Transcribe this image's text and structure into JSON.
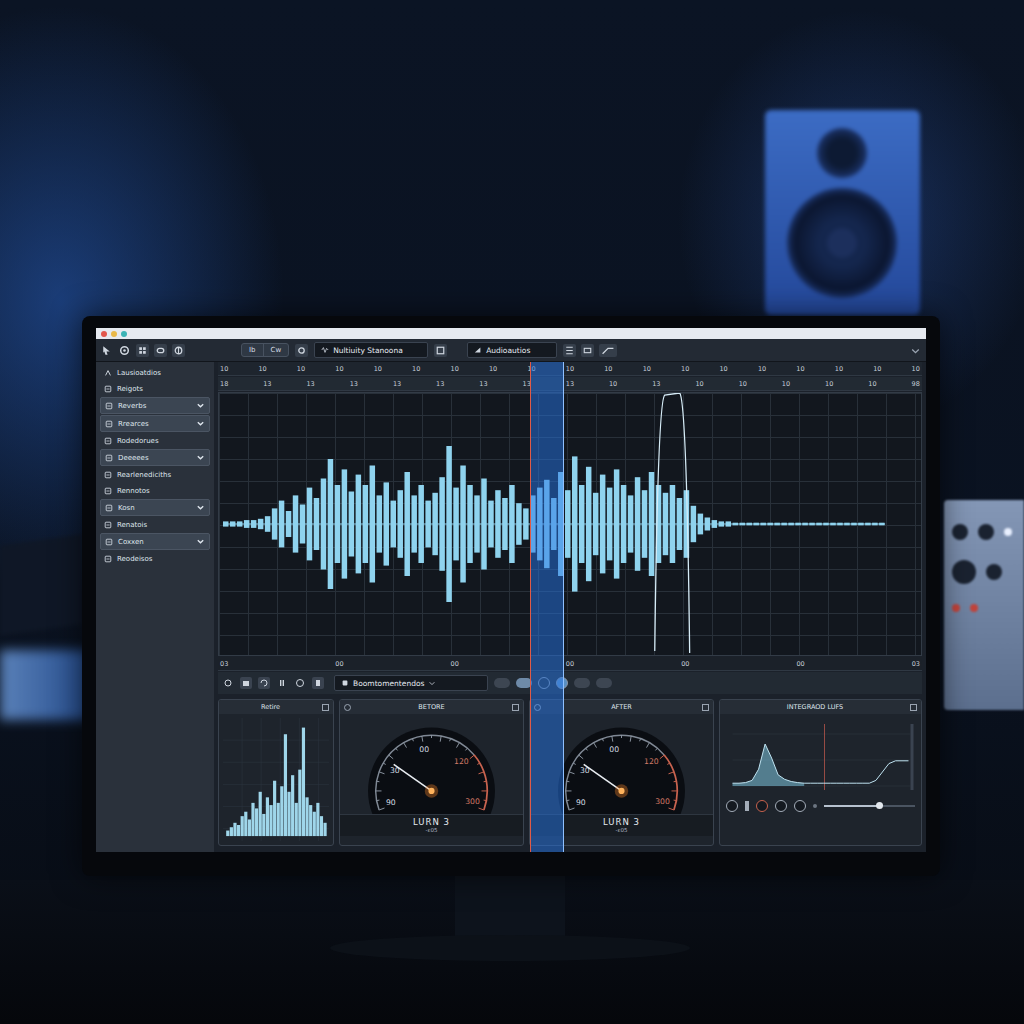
{
  "window": {
    "title": "Nultiuity Stanoona",
    "subtitle": "Audioautios"
  },
  "toolbar": {
    "segment": [
      "Ib",
      "Cw"
    ]
  },
  "sidebar": {
    "header": "Lausioatdios",
    "items": [
      {
        "label": "Reigots",
        "expanded": false
      },
      {
        "label": "Reverbs",
        "expanded": true
      },
      {
        "label": "Rrearces",
        "expanded": true
      },
      {
        "label": "Rodedorues",
        "expanded": false
      },
      {
        "label": "Deeeees",
        "expanded": true
      },
      {
        "label": "Rearlenediciths",
        "expanded": false
      },
      {
        "label": "Rennotos",
        "expanded": false
      },
      {
        "label": "Kosn",
        "expanded": true
      },
      {
        "label": "Renatois",
        "expanded": false
      },
      {
        "label": "Coxxen",
        "expanded": true
      },
      {
        "label": "Reodeisos",
        "expanded": false
      }
    ]
  },
  "ruler": {
    "top": [
      "10",
      "10",
      "10",
      "10",
      "10",
      "10",
      "10",
      "10",
      "10",
      "10",
      "10",
      "10",
      "10",
      "10",
      "10",
      "10",
      "10",
      "10",
      "10"
    ],
    "bottom": [
      "18",
      "13",
      "13",
      "13",
      "13",
      "13",
      "13",
      "13",
      "13",
      "10",
      "13",
      "10",
      "10",
      "10",
      "10",
      "10",
      "98"
    ]
  },
  "waveform": {
    "values": [
      0.02,
      0.02,
      0.02,
      0.03,
      0.03,
      0.04,
      0.06,
      0.12,
      0.18,
      0.1,
      0.22,
      0.15,
      0.28,
      0.2,
      0.35,
      0.5,
      0.3,
      0.42,
      0.25,
      0.38,
      0.3,
      0.45,
      0.22,
      0.32,
      0.18,
      0.26,
      0.4,
      0.22,
      0.3,
      0.18,
      0.24,
      0.36,
      0.6,
      0.28,
      0.45,
      0.3,
      0.22,
      0.35,
      0.18,
      0.26,
      0.2,
      0.3,
      0.16,
      0.12,
      0.22,
      0.28,
      0.34,
      0.2,
      0.4,
      0.26,
      0.52,
      0.3,
      0.44,
      0.24,
      0.38,
      0.28,
      0.42,
      0.3,
      0.22,
      0.36,
      0.26,
      0.4,
      0.3,
      0.24,
      0.3,
      0.2,
      0.26,
      0.14,
      0.08,
      0.05,
      0.03,
      0.02,
      0.02,
      0.01,
      0.01,
      0.01,
      0.01,
      0.01,
      0.01,
      0.01,
      0.01,
      0.01,
      0.01,
      0.01,
      0.01,
      0.01,
      0.01,
      0.01,
      0.01,
      0.01,
      0.01,
      0.01,
      0.01,
      0.01,
      0.01
    ]
  },
  "selection": {
    "level": 0.443
  },
  "footer_ruler": [
    "03",
    "00",
    "00",
    "00",
    "00",
    "00",
    "03"
  ],
  "transport": {
    "field": "Boomtomentendos"
  },
  "spectrum": {
    "title": "Retire",
    "values": [
      0.05,
      0.08,
      0.12,
      0.1,
      0.18,
      0.22,
      0.15,
      0.3,
      0.25,
      0.4,
      0.2,
      0.35,
      0.28,
      0.5,
      0.3,
      0.45,
      0.92,
      0.4,
      0.55,
      0.3,
      0.6,
      0.98,
      0.35,
      0.28,
      0.22,
      0.3,
      0.18,
      0.12
    ]
  },
  "gauges": [
    {
      "title": "BETORE",
      "ticks": [
        "90",
        "30",
        "00",
        "120",
        "300"
      ],
      "reading": "LURN 3",
      "sub": "-ε05",
      "level": 0.25
    },
    {
      "title": "AFTER",
      "ticks": [
        "90",
        "30",
        "00",
        "120",
        "300"
      ],
      "reading": "LURN 3",
      "sub": "-ε05",
      "level": 0.25
    }
  ],
  "lufs": {
    "title": "INTEGRAOD LUFS",
    "values": [
      0.05,
      0.05,
      0.06,
      0.1,
      0.3,
      0.75,
      0.5,
      0.2,
      0.12,
      0.08,
      0.06,
      0.05,
      0.05,
      0.05,
      0.05,
      0.05,
      0.05,
      0.05,
      0.05,
      0.05,
      0.05,
      0.05,
      0.1,
      0.25,
      0.4,
      0.45,
      0.45,
      0.45
    ],
    "slider": {
      "level": 0.6
    }
  }
}
